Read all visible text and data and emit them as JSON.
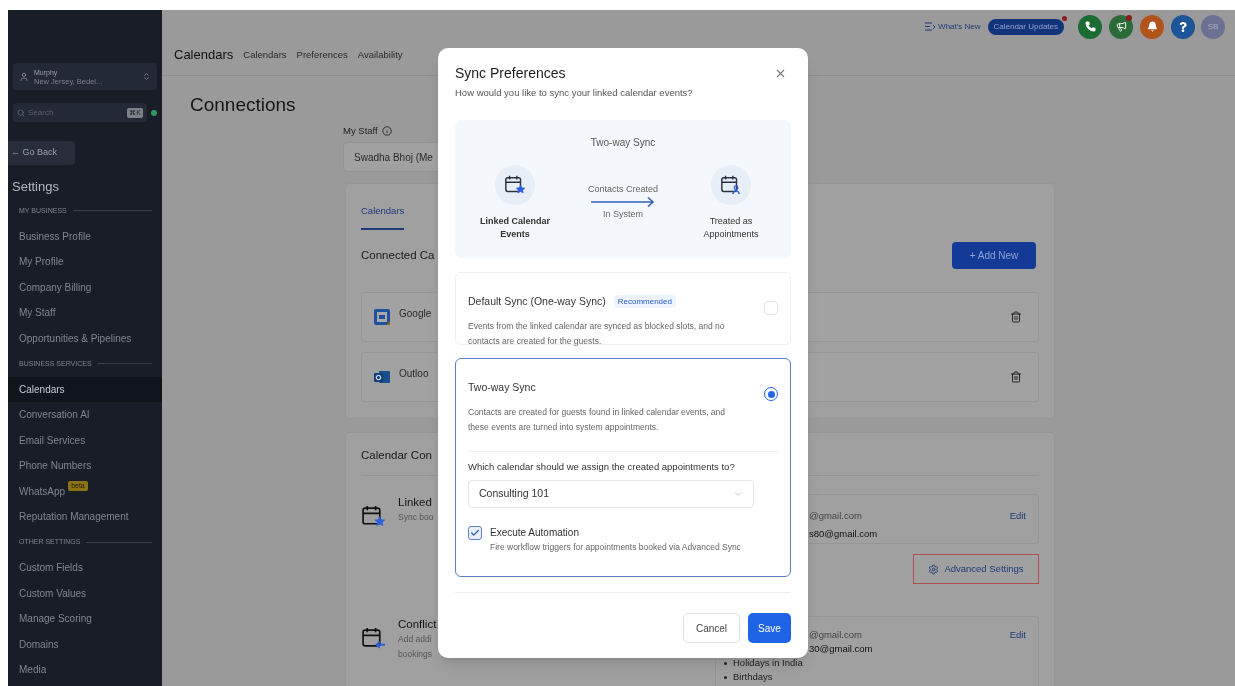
{
  "sidebar": {
    "account": {
      "name": "Murphy",
      "location": "New Jersey, Bedel..."
    },
    "search": {
      "placeholder": "Search",
      "shortcut": "⌘K",
      "online": true
    },
    "back": "← Go Back",
    "title": "Settings",
    "sections": [
      {
        "label": "MY BUSINESS",
        "items": [
          {
            "label": "Business Profile",
            "selected": false
          },
          {
            "label": "My Profile",
            "selected": false
          },
          {
            "label": "Company Billing",
            "selected": false
          },
          {
            "label": "My Staff",
            "selected": false
          },
          {
            "label": "Opportunities & Pipelines",
            "selected": false
          }
        ]
      },
      {
        "label": "BUSINESS SERVICES",
        "items": [
          {
            "label": "Calendars",
            "selected": true
          },
          {
            "label": "Conversation AI",
            "selected": false
          },
          {
            "label": "Email Services",
            "selected": false
          },
          {
            "label": "Phone Numbers",
            "selected": false
          },
          {
            "label": "WhatsApp",
            "badge": "beta",
            "selected": false
          },
          {
            "label": "Reputation Management",
            "selected": false
          }
        ]
      },
      {
        "label": "OTHER SETTINGS",
        "items": [
          {
            "label": "Custom Fields",
            "selected": false
          },
          {
            "label": "Custom Values",
            "selected": false
          },
          {
            "label": "Manage Scoring",
            "selected": false
          },
          {
            "label": "Domains",
            "selected": false
          },
          {
            "label": "Media",
            "selected": false
          }
        ]
      }
    ]
  },
  "topbar": {
    "whats_new": "What's New",
    "updates": {
      "label": "Calendar Updates",
      "notify": true
    },
    "actions": [
      {
        "kind": "phone",
        "notify": false
      },
      {
        "kind": "megaphone",
        "notify": true
      },
      {
        "kind": "bell",
        "notify": false
      },
      {
        "kind": "help",
        "notify": false
      }
    ],
    "avatar": "SB",
    "title": "Calendars",
    "tabs": [
      "Calendars",
      "Preferences",
      "Availability"
    ]
  },
  "page": {
    "title": "Connections",
    "staff": {
      "label": "My Staff",
      "value": "Swadha Bhoj (Me"
    },
    "connections": {
      "tabs": [
        {
          "label": "Calendars",
          "selected": true
        }
      ],
      "title": "Connected Ca",
      "add_button": "+ Add New",
      "accounts": [
        {
          "kind": "google",
          "name": "Google"
        },
        {
          "kind": "outlook",
          "name": "Outloo"
        }
      ]
    },
    "config": {
      "title": "Calendar Con",
      "items": [
        {
          "kind": "linked",
          "title": "Linked",
          "description": [
            "Sync boo"
          ],
          "emails": [
            "@gmail.com",
            "s80@gmail.com"
          ],
          "edit": "Edit",
          "settings_button": "Advanced Settings"
        },
        {
          "kind": "conflict",
          "title": "Conflict",
          "description": [
            "Add addi",
            "bookings"
          ],
          "emails": [
            "@gmail.com",
            "30@gmail.com"
          ],
          "calendars": [
            "Holidays in India",
            "Birthdays"
          ],
          "edit": "Edit"
        }
      ]
    }
  },
  "modal": {
    "title": "Sync Preferences",
    "subtitle": "How would you like to sync your linked calendar events?",
    "diagram": {
      "title": "Two-way Sync",
      "source": "Linked Calendar Events",
      "arrow_top": "Contacts Created",
      "arrow_bottom": "In System",
      "target": "Treated as Appointments"
    },
    "options": [
      {
        "title": "Default Sync (One-way Sync)",
        "badge": "Recommended",
        "description": "Events from the linked calendar are synced as blocked slots, and no contacts are created for the guests.",
        "selected": false
      },
      {
        "title": "Two-way Sync",
        "description": "Contacts are created for guests found in linked calendar events, and these events are turned into system appointments.",
        "selected": true,
        "assign": {
          "question": "Which calendar should we assign the created appointments to?",
          "value": "Consulting 101",
          "automation": {
            "label": "Execute Automation",
            "description": "Fire workflow triggers for appointments booked via Advanced Sync",
            "checked": true
          }
        }
      }
    ],
    "buttons": {
      "cancel": "Cancel",
      "save": "Save"
    }
  }
}
